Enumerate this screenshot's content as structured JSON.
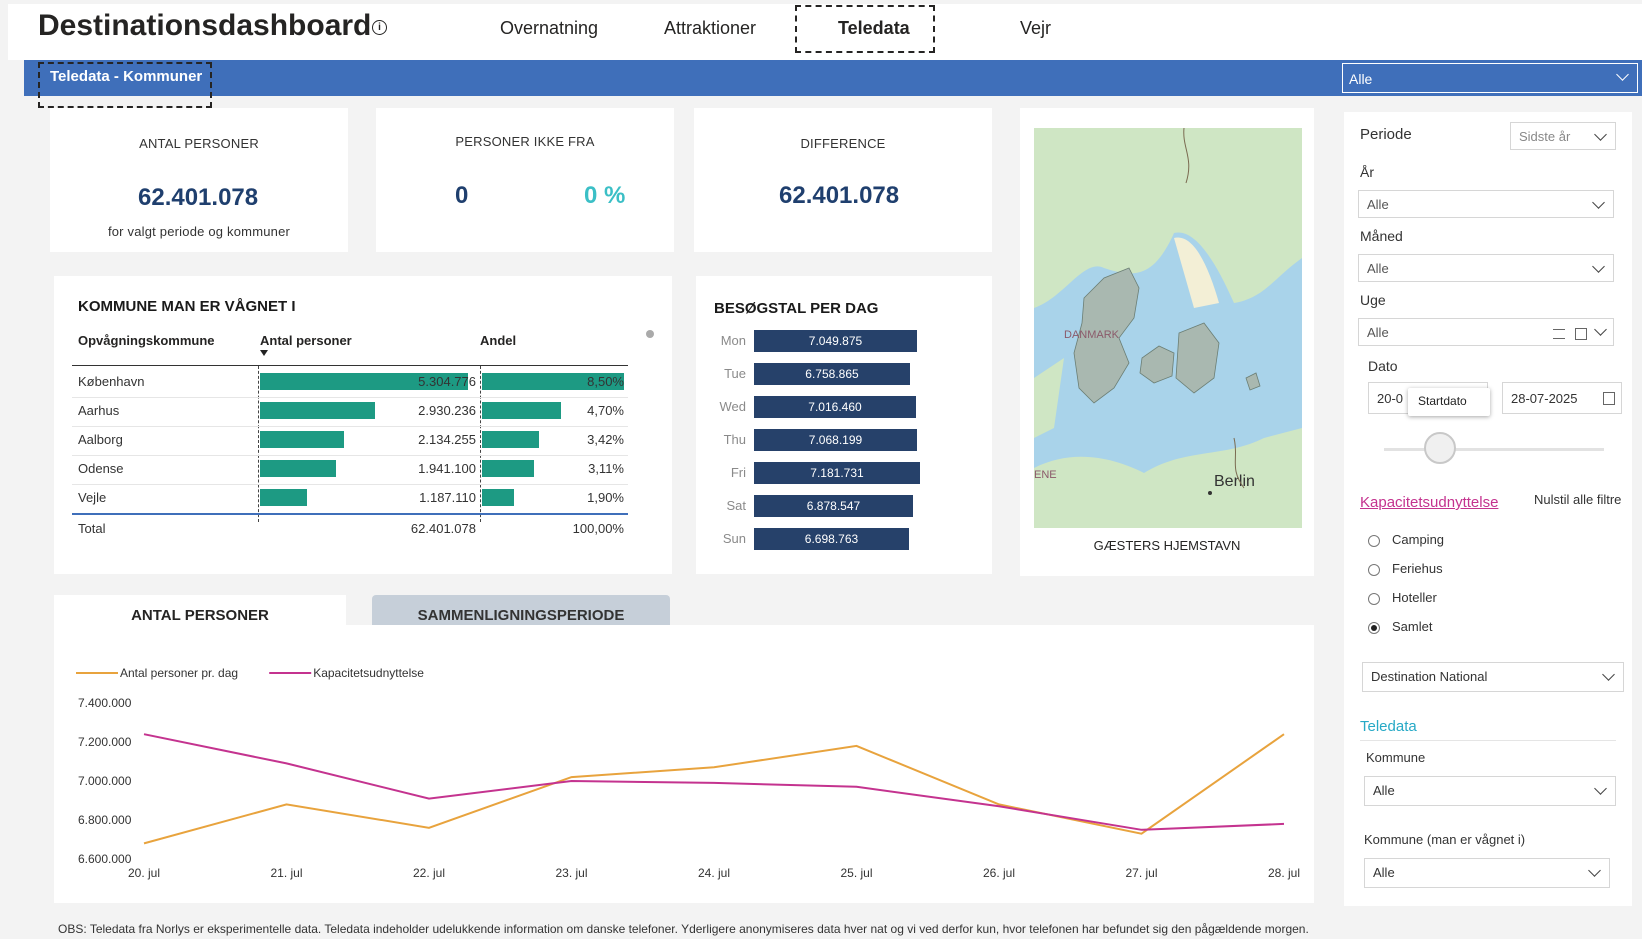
{
  "header": {
    "title": "Destinationsdashboard",
    "info_symbol": "i",
    "tabs": [
      "Overnatning",
      "Attraktioner",
      "Teledata",
      "Vejr"
    ],
    "active_tab": "Teledata"
  },
  "section_bar": {
    "title": "Teledata - Kommuner",
    "filter_value": "Alle"
  },
  "kpis": {
    "antal_personer": {
      "label": "ANTAL PERSONER",
      "value": "62.401.078",
      "sub": "for valgt periode og kommuner"
    },
    "personer_ikke_fra": {
      "label": "PERSONER IKKE FRA",
      "value": "0",
      "percent": "0 %"
    },
    "difference": {
      "label": "DIFFERENCE",
      "value": "62.401.078"
    }
  },
  "kommune_table": {
    "title": "KOMMUNE MAN ER VÅGNET I",
    "headers": [
      "Opvågningskommune",
      "Antal personer",
      "Andel"
    ],
    "rows": [
      {
        "name": "København",
        "count": "5.304.776",
        "share": "8,50%",
        "count_frac": 1.0,
        "share_frac": 1.0
      },
      {
        "name": "Aarhus",
        "count": "2.930.236",
        "share": "4,70%",
        "count_frac": 0.552,
        "share_frac": 0.553
      },
      {
        "name": "Aalborg",
        "count": "2.134.255",
        "share": "3,42%",
        "count_frac": 0.402,
        "share_frac": 0.402
      },
      {
        "name": "Odense",
        "count": "1.941.100",
        "share": "3,11%",
        "count_frac": 0.366,
        "share_frac": 0.366
      },
      {
        "name": "Vejle",
        "count": "1.187.110",
        "share": "1,90%",
        "count_frac": 0.224,
        "share_frac": 0.224
      }
    ],
    "total": {
      "label": "Total",
      "count": "62.401.078",
      "share": "100,00%"
    }
  },
  "besoegstal": {
    "title": "BESØGSTAL PER DAG",
    "days": [
      {
        "day": "Mon",
        "value": 7049875,
        "label": "7.049.875"
      },
      {
        "day": "Tue",
        "value": 6758865,
        "label": "6.758.865"
      },
      {
        "day": "Wed",
        "value": 7016460,
        "label": "7.016.460"
      },
      {
        "day": "Thu",
        "value": 7068199,
        "label": "7.068.199"
      },
      {
        "day": "Fri",
        "value": 7181731,
        "label": "7.181.731"
      },
      {
        "day": "Sat",
        "value": 6878547,
        "label": "6.878.547"
      },
      {
        "day": "Sun",
        "value": 6698763,
        "label": "6.698.763"
      }
    ]
  },
  "map": {
    "caption": "GÆSTERS HJEMSTAVN",
    "labels": {
      "country": "DANMARK",
      "city": "Berlin",
      "edge": "ENE"
    },
    "colors": {
      "water": "#a9d3ea",
      "land": "#cfe6c4",
      "municipality": "#a9b8b0"
    }
  },
  "lower_tabs": [
    "ANTAL PERSONER",
    "SAMMENLIGNINGSPERIODE"
  ],
  "chart_data": {
    "type": "line",
    "x": [
      "20. jul",
      "21. jul",
      "22. jul",
      "23. jul",
      "24. jul",
      "25. jul",
      "26. jul",
      "27. jul",
      "28. jul"
    ],
    "series": [
      {
        "name": "Antal personer pr. dag",
        "color": "#e8a33d",
        "values": [
          6680000,
          6880000,
          6760000,
          7020000,
          7070000,
          7180000,
          6880000,
          6730000,
          7240000
        ]
      },
      {
        "name": "Kapacitetsudnyttelse",
        "color": "#c4338f",
        "values": [
          7240000,
          7090000,
          6910000,
          7000000,
          6990000,
          6970000,
          6870000,
          6750000,
          6780000
        ]
      }
    ],
    "y_ticks": [
      "7.400.000",
      "7.200.000",
      "7.000.000",
      "6.800.000",
      "6.600.000"
    ],
    "ylim": [
      6600000,
      7400000
    ],
    "legend_position": "top-left"
  },
  "slicers": {
    "periode": {
      "label": "Periode",
      "value": "Sidste år"
    },
    "aar": {
      "label": "År",
      "value": "Alle"
    },
    "maaned": {
      "label": "Måned",
      "value": "Alle"
    },
    "uge": {
      "label": "Uge",
      "value": "Alle"
    },
    "dato": {
      "label": "Dato",
      "start": "20-0",
      "end": "28-07-2025",
      "tooltip": "Startdato",
      "range_start_fraction": 0.1
    },
    "kapacitet": {
      "label": "Kapacitetsudnyttelse",
      "reset": "Nulstil alle filtre",
      "options": [
        "Camping",
        "Feriehus",
        "Hoteller",
        "Samlet"
      ],
      "selected": "Samlet"
    },
    "destination": {
      "value": "Destination National"
    },
    "teledata": {
      "label": "Teledata",
      "kommune_label": "Kommune",
      "kommune_value": "Alle",
      "vaagnet_label": "Kommune (man er vågnet i)",
      "vaagnet_value": "Alle"
    }
  },
  "footer": {
    "obs_label": "OBS:",
    "text": "Teledata fra Norlys er eksperimentelle data. Teledata indeholder udelukkende information om danske telefoner. Yderligere anonymiseres data hver nat og vi ved derfor kun, hvor telefonen har befundet sig den pågældende morgen."
  },
  "colors": {
    "accent_blue": "#3f6fba",
    "teal": "#1d9a83",
    "navy": "#26416a",
    "kpi_blue": "#1f3f6e",
    "kpi_teal": "#3bbfc6",
    "pink": "#c4338f"
  }
}
